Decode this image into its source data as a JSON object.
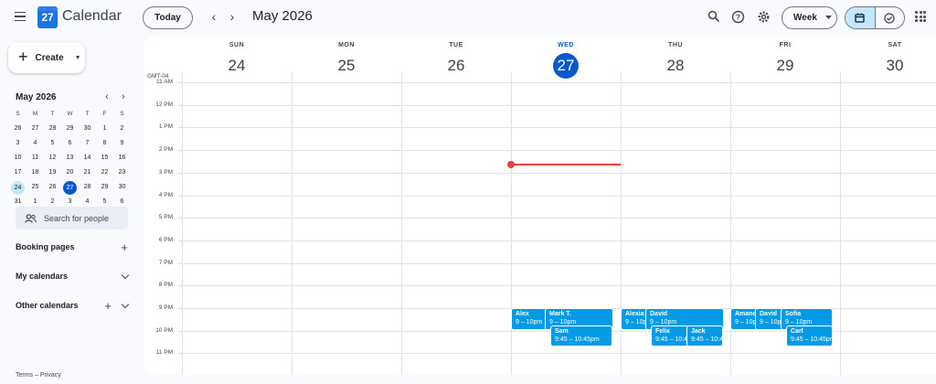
{
  "app": {
    "logo_text": "27",
    "title": "Calendar"
  },
  "toolbar": {
    "today_label": "Today",
    "prev_symbol": "‹",
    "next_symbol": "›",
    "period": "May 2026",
    "view_label": "Week"
  },
  "sidebar": {
    "create_label": "Create",
    "mini_cal": {
      "title": "May 2026",
      "dow": [
        "S",
        "M",
        "T",
        "W",
        "T",
        "F",
        "S"
      ],
      "weeks": [
        [
          "26",
          "27",
          "28",
          "29",
          "30",
          "1",
          "2"
        ],
        [
          "3",
          "4",
          "5",
          "6",
          "7",
          "8",
          "9"
        ],
        [
          "10",
          "11",
          "12",
          "13",
          "14",
          "15",
          "16"
        ],
        [
          "17",
          "18",
          "19",
          "20",
          "21",
          "22",
          "23"
        ],
        [
          "24",
          "25",
          "26",
          "27",
          "28",
          "29",
          "30"
        ],
        [
          "31",
          "1",
          "2",
          "3",
          "4",
          "5",
          "6"
        ]
      ],
      "selected": "24",
      "today": "27"
    },
    "search_people_placeholder": "Search for people",
    "booking_pages": "Booking pages",
    "my_calendars": "My calendars",
    "other_calendars": "Other calendars",
    "footer": "Terms – Privacy"
  },
  "week": {
    "timezone": "GMT-04",
    "days": [
      {
        "dow": "SUN",
        "num": "24",
        "today": false
      },
      {
        "dow": "MON",
        "num": "25",
        "today": false
      },
      {
        "dow": "TUE",
        "num": "26",
        "today": false
      },
      {
        "dow": "WED",
        "num": "27",
        "today": true
      },
      {
        "dow": "THU",
        "num": "28",
        "today": false
      },
      {
        "dow": "FRI",
        "num": "29",
        "today": false
      },
      {
        "dow": "SAT",
        "num": "30",
        "today": false
      }
    ],
    "hours": [
      "11 AM",
      "12 PM",
      "1 PM",
      "2 PM",
      "3 PM",
      "4 PM",
      "5 PM",
      "6 PM",
      "7 PM",
      "8 PM",
      "9 PM",
      "10 PM",
      "11 PM"
    ],
    "events": [
      {
        "day": 3,
        "title": "Alex",
        "time": "9 – 10pm",
        "start": 21.0,
        "end": 22.0,
        "col": 0
      },
      {
        "day": 3,
        "title": "Mark T.",
        "time": "9 – 10pm",
        "start": 21.0,
        "end": 22.0,
        "col": 1
      },
      {
        "day": 3,
        "title": "Sam",
        "time": "9:45 – 10:45pm",
        "start": 21.75,
        "end": 22.75,
        "col": 2
      },
      {
        "day": 4,
        "title": "Alexia",
        "time": "9 – 10pm",
        "start": 21.0,
        "end": 22.0,
        "col": 0
      },
      {
        "day": 4,
        "title": "David",
        "time": "9 – 10pm",
        "start": 21.0,
        "end": 22.0,
        "col": 1
      },
      {
        "day": 4,
        "title": "Felix",
        "time": "9:45 – 10:45pm",
        "start": 21.75,
        "end": 22.75,
        "col": 2
      },
      {
        "day": 4,
        "title": "Jack",
        "time": "9:45 – 10:45pm",
        "start": 21.75,
        "end": 22.75,
        "col": 3
      },
      {
        "day": 5,
        "title": "Amanda",
        "time": "9 – 10pm",
        "start": 21.0,
        "end": 22.0,
        "col": 0
      },
      {
        "day": 5,
        "title": "David",
        "time": "9 – 10pm",
        "start": 21.0,
        "end": 22.0,
        "col": 1
      },
      {
        "day": 5,
        "title": "Sofia",
        "time": "9 – 10pm",
        "start": 21.0,
        "end": 22.0,
        "col": 2
      },
      {
        "day": 5,
        "title": "Carl",
        "time": "9:45 – 10:45pm",
        "start": 21.75,
        "end": 22.75,
        "col": 3
      }
    ],
    "current_time": 14.65
  },
  "colors": {
    "accent": "#0b57d0",
    "event": "#039be5",
    "now": "#ea4335"
  }
}
